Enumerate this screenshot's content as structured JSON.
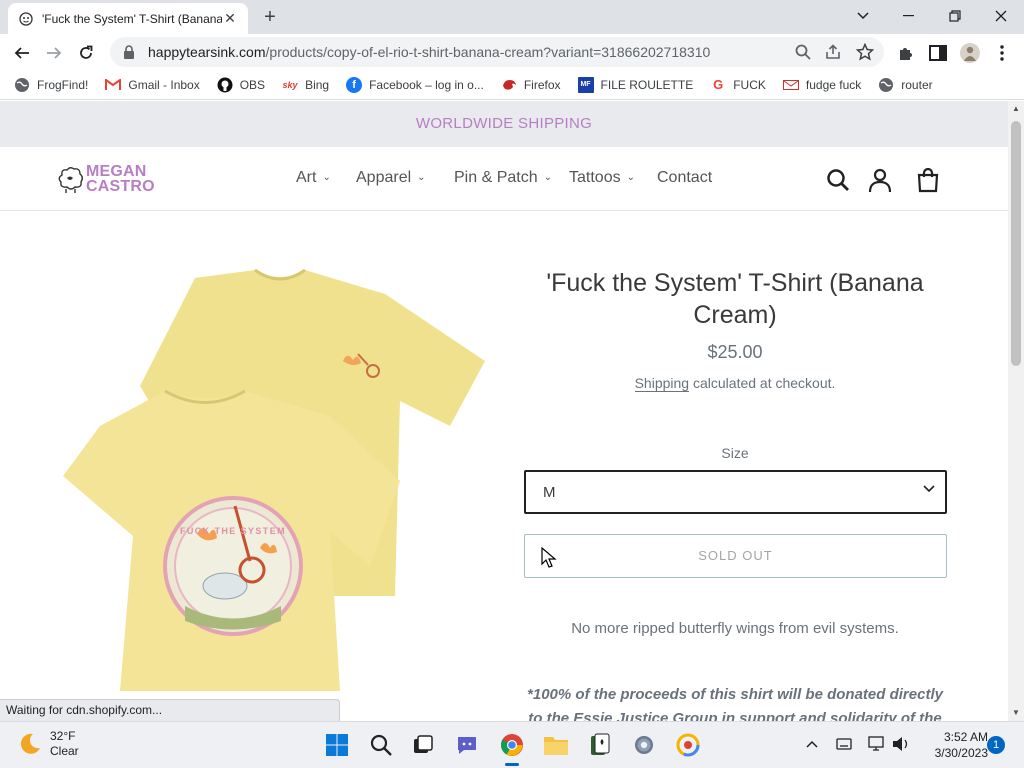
{
  "browser": {
    "tab": {
      "title": "'Fuck the System' T-Shirt (Banana",
      "close_icon": "close-icon"
    },
    "url": {
      "domain": "happytearsink.com",
      "path": "/products/copy-of-el-rio-t-shirt-banana-cream?variant=31866202718310"
    },
    "bookmarks": [
      {
        "label": "FrogFind!",
        "icon": "globe-icon"
      },
      {
        "label": "Gmail - Inbox",
        "icon": "gmail-icon"
      },
      {
        "label": "OBS",
        "icon": "github-icon"
      },
      {
        "label": "Bing",
        "icon": "sky-icon"
      },
      {
        "label": "Facebook – log in o...",
        "icon": "facebook-icon"
      },
      {
        "label": "Firefox",
        "icon": "firefox-icon"
      },
      {
        "label": "FILE ROULETTE",
        "icon": "file-roulette-icon"
      },
      {
        "label": "FUCK",
        "icon": "google-icon"
      },
      {
        "label": "fudge fuck",
        "icon": "mail-icon"
      },
      {
        "label": "router",
        "icon": "globe-icon"
      }
    ],
    "status": "Waiting for cdn.shopify.com..."
  },
  "site": {
    "announcement": "WORLDWIDE SHIPPING",
    "logo": {
      "line1": "MEGAN",
      "line2": "CASTRO"
    },
    "nav": [
      {
        "label": "Art",
        "has_dropdown": true
      },
      {
        "label": "Apparel",
        "has_dropdown": true
      },
      {
        "label": "Pin & Patch",
        "has_dropdown": true
      },
      {
        "label": "Tattoos",
        "has_dropdown": true
      },
      {
        "label": "Contact",
        "has_dropdown": false
      }
    ]
  },
  "product": {
    "title": "'Fuck the System' T-Shirt (Banana Cream)",
    "price": "$25.00",
    "shipping_link": "Shipping",
    "shipping_note": " calculated at checkout.",
    "size_label": "Size",
    "size_selected": "M",
    "button_label": "SOLD OUT",
    "description": "No more ripped butterfly wings from evil systems.",
    "donation_line1": "*100% of the proceeds of this shirt will be donated directly",
    "donation_line2": "to the Essie Justice Group in support and solidarity of the",
    "patch_text": "FUCK THE SYSTEM"
  },
  "taskbar": {
    "weather": {
      "temp": "32°F",
      "condition": "Clear"
    },
    "time": "3:52 AM",
    "date": "3/30/2023",
    "notifications": "1"
  },
  "colors": {
    "accent": "#b87ec5",
    "shirt": "#f1e597",
    "soldout_border": "#a3c4c6"
  }
}
